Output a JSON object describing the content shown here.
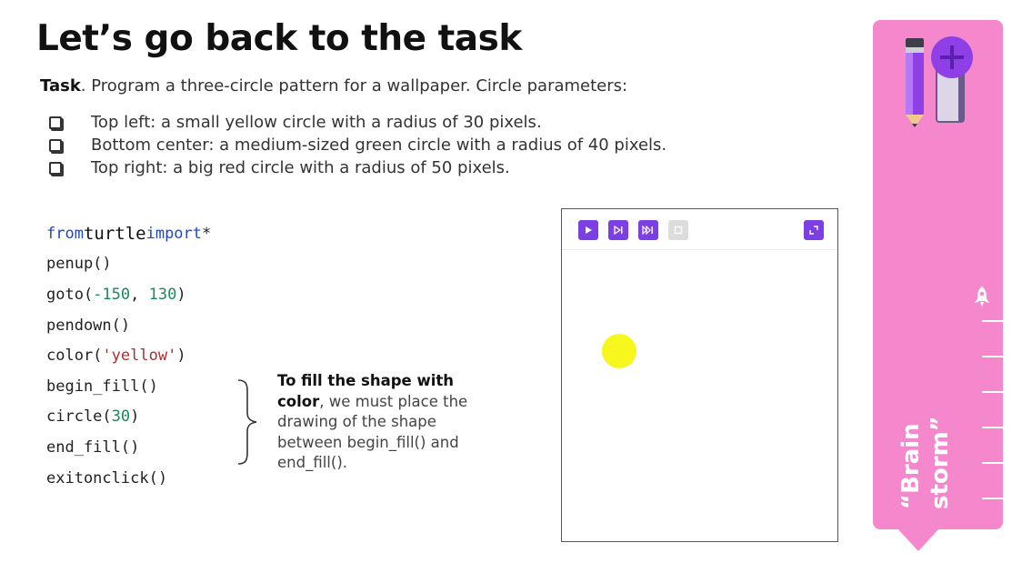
{
  "slide": {
    "title": "Let’s go back to the task",
    "task_label": "Task",
    "task_text": ". Program a three-circle pattern for a wallpaper. Circle parameters:",
    "parameters": [
      "Top left: a small yellow circle with a radius of 30 pixels.",
      "Bottom center: a medium-sized green circle with a radius of 40 pixels.",
      "Top right: a big red circle with a radius of 50 pixels."
    ]
  },
  "code": {
    "from_kw": "from",
    "module": "turtle",
    "import_kw": "import",
    "star": "*",
    "penup": "penup()",
    "goto_open": "goto(",
    "goto_x": "-150",
    "goto_sep": ", ",
    "goto_y": "130",
    "goto_close": ")",
    "pendown": "pendown()",
    "color_open": "color(",
    "color_val": "'yellow'",
    "color_close": ")",
    "begin_fill": "begin_fill()",
    "circle_open": "circle(",
    "circle_val": "30",
    "circle_close": ")",
    "end_fill": "end_fill()",
    "exitonclick": "exitonclick()"
  },
  "note": {
    "bold": "To fill the shape with color",
    "rest": ", we must place the drawing of the shape between begin_fill() and end_fill()."
  },
  "turtle_window": {
    "run_icon": "play-icon",
    "step_icon": "step-forward-icon",
    "step_over_icon": "skip-forward-icon",
    "stop_icon": "stop-icon",
    "fullscreen_icon": "fullscreen-icon",
    "circle_color": "#f7f71e"
  },
  "sidebar": {
    "label_line1": "“Brain",
    "label_line2": "storm”",
    "accent": "#f587cd",
    "icons": [
      "pencil-book-plus-icon",
      "rocket-icon"
    ]
  }
}
